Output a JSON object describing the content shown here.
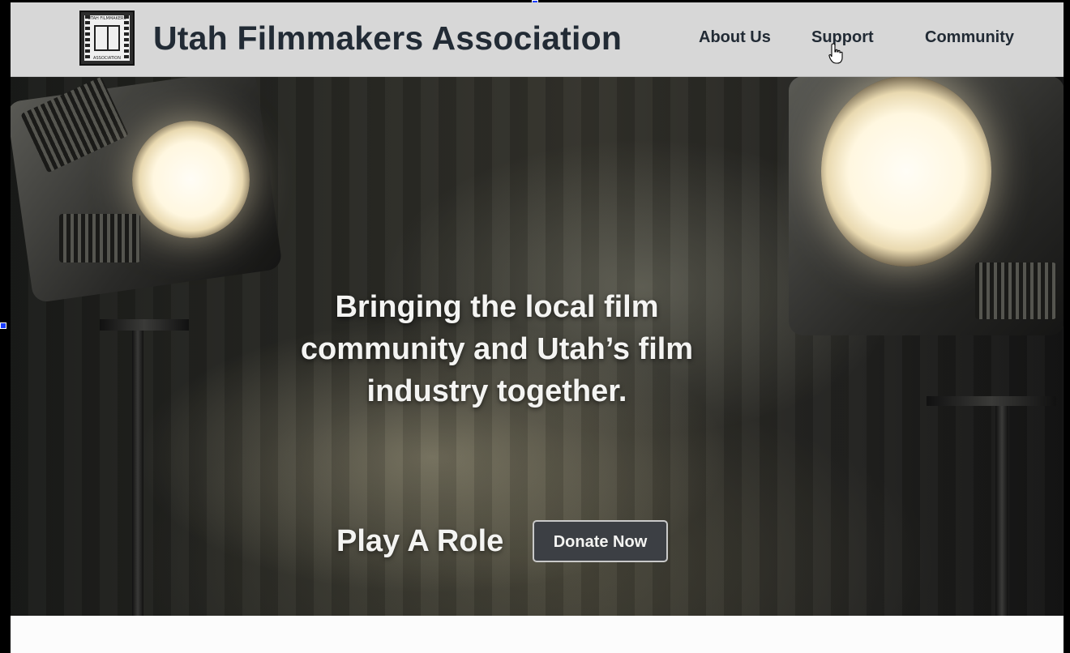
{
  "header": {
    "site_title": "Utah Filmmakers Association",
    "logo": {
      "icon": "film-logo-icon",
      "top_text": "UTAH FILMMAKERS",
      "bottom_text": "ASSOCIATION"
    },
    "nav": [
      {
        "label": "About Us"
      },
      {
        "label": "Support"
      },
      {
        "label": "Community"
      }
    ]
  },
  "hero": {
    "tagline": "Bringing the local film community and Utah’s film industry together.",
    "cta_text": "Play A Role",
    "donate_label": "Donate Now"
  },
  "colors": {
    "header_bg": "#d7d7d7",
    "title_text": "#222b35",
    "button_bg": "#3c3f44"
  }
}
